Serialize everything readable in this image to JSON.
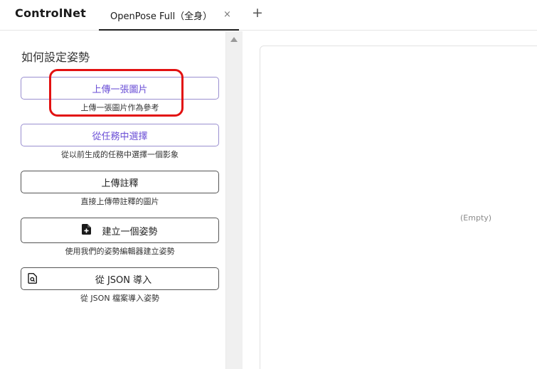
{
  "app": {
    "title": "ControlNet"
  },
  "tabs": [
    {
      "label": "OpenPose Full（全身）",
      "close": "×"
    }
  ],
  "add_tab": "+",
  "sidebar": {
    "heading": "如何設定姿勢",
    "options": [
      {
        "label": "上傳一張圖片",
        "caption": "上傳一張圖片作為參考"
      },
      {
        "label": "從任務中選擇",
        "caption": "從以前生成的任務中選擇一個影象"
      },
      {
        "label": "上傳註釋",
        "caption": "直接上傳帶註釋的圖片"
      },
      {
        "label": "建立一個姿勢",
        "caption": "使用我們的姿勢編輯器建立姿勢",
        "icon": "file-plus-icon"
      },
      {
        "label": "從 JSON 導入",
        "caption": "從 JSON 檔案導入姿勢",
        "icon": "file-search-icon"
      }
    ]
  },
  "canvas": {
    "empty_label": "(Empty)"
  },
  "colors": {
    "accent": "#6a4ed6",
    "highlight": "#e21111"
  }
}
